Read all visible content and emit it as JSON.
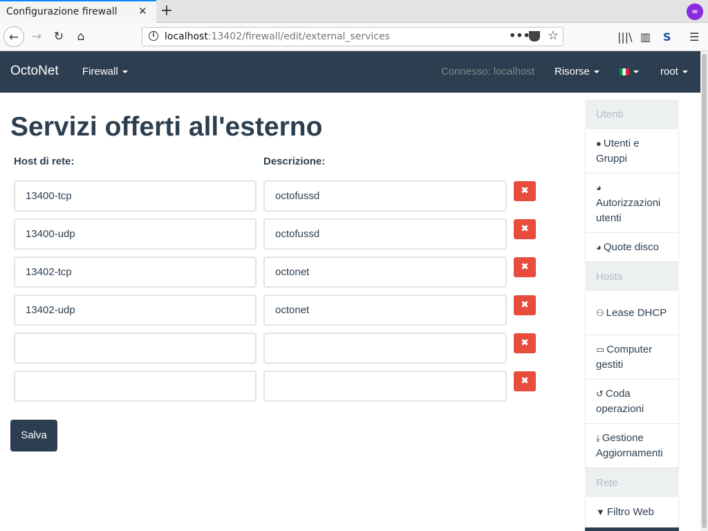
{
  "browser": {
    "tab_title": "Configurazione firewall",
    "url_host": "localhost",
    "url_rest": ":13402/firewall/edit/external_services"
  },
  "navbar": {
    "brand": "OctoNet",
    "firewall_menu": "Firewall",
    "connection": "Connesso: localhost",
    "resources_menu": "Risorse",
    "user_menu": "root"
  },
  "main": {
    "title": "Servizi offerti all'esterno",
    "host_label": "Host di rete:",
    "desc_label": "Descrizione:",
    "rows": [
      {
        "host": "13400-tcp",
        "desc": "octofussd"
      },
      {
        "host": "13400-udp",
        "desc": "octofussd"
      },
      {
        "host": "13402-tcp",
        "desc": "octonet"
      },
      {
        "host": "13402-udp",
        "desc": "octonet"
      },
      {
        "host": "",
        "desc": ""
      },
      {
        "host": "",
        "desc": ""
      }
    ],
    "save_label": "Salva"
  },
  "sidebar": {
    "sections": [
      {
        "header": "Utenti",
        "items": [
          {
            "icon": "user-circle-icon",
            "label": "Utenti e Gruppi"
          },
          {
            "icon": "pie-chart-icon",
            "label": "Autorizzazioni utenti"
          },
          {
            "icon": "pie-chart-icon",
            "label": "Quote disco"
          }
        ]
      },
      {
        "header": "Hosts",
        "items": [
          {
            "icon": "handshake-icon",
            "label": "Lease DHCP"
          },
          {
            "icon": "desktop-icon",
            "label": "Computer gestiti"
          },
          {
            "icon": "history-icon",
            "label": "Coda operazioni"
          },
          {
            "icon": "download-icon",
            "label": "Gestione Aggiornamenti"
          }
        ]
      },
      {
        "header": "Rete",
        "items": [
          {
            "icon": "filter-icon",
            "label": "Filtro Web"
          }
        ]
      }
    ]
  },
  "colors": {
    "primary": "#2c3e50",
    "danger": "#e74c3c",
    "muted_header": "#ecf0f1"
  }
}
